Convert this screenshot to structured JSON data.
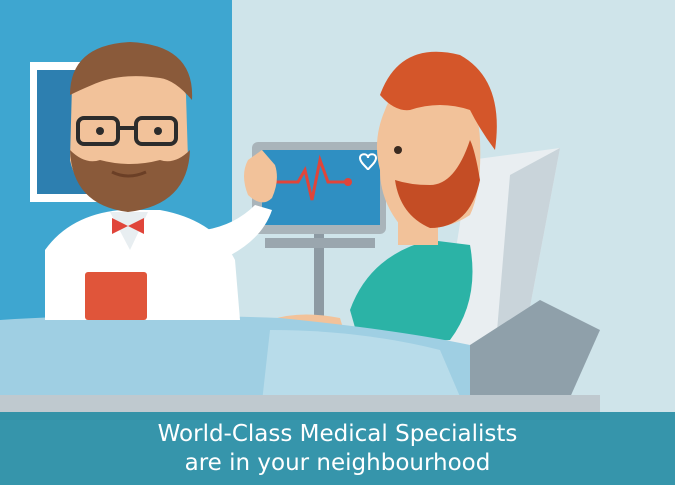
{
  "caption": {
    "line1": "World-Class Medical Specialists",
    "line2": "are in your neighbourhood"
  },
  "icons": {
    "monitor_heart": "heart-icon",
    "ekg_trace": "heartbeat-line-icon"
  },
  "colors": {
    "background": "#cfe4ea",
    "wall_panel": "#3ea6d0",
    "caption_band": "#218aa2",
    "doctor_coat": "#ffffff",
    "patient_hair": "#d4562a",
    "patient_gown": "#2bb3a6",
    "clipboard": "#e0553a",
    "ekg_line": "#e0453a"
  }
}
